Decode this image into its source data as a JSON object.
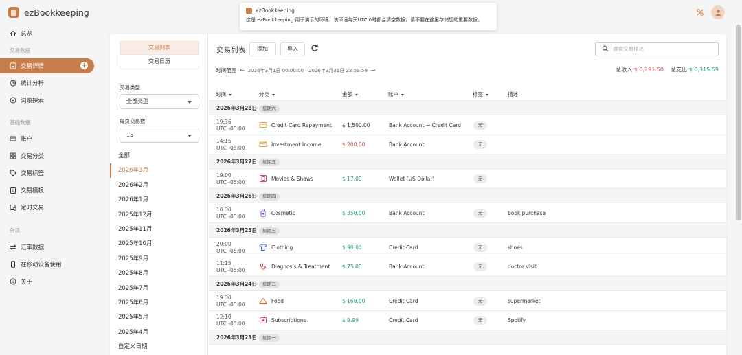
{
  "app": {
    "name": "ezBookkeeping"
  },
  "notice": {
    "title": "ezBookkeeping",
    "text": "这是 ezBookkeeping 用于演示的环境，该环境每天UTC 0时都会清空数据，请不要在这里存储您的重要数据。"
  },
  "sidebar": {
    "overview": "总览",
    "section_tx": "交易数据",
    "tx_detail": "交易详情",
    "stats": "统计分析",
    "explore": "洞察探索",
    "section_base": "基础数据",
    "accounts": "账户",
    "categories": "交易分类",
    "tags": "交易标签",
    "templates": "交易模板",
    "scheduled": "定时交易",
    "section_misc": "杂项",
    "exchange": "汇率数据",
    "mobile": "在移动设备使用",
    "about": "关于"
  },
  "filter": {
    "tab_list": "交易列表",
    "tab_calendar": "交易日历",
    "type_label": "交易类型",
    "type_value": "全部类型",
    "perpage_label": "每页交易数",
    "perpage_value": "15",
    "dates": [
      "全部",
      "2026年3月",
      "2026年2月",
      "2026年1月",
      "2025年12月",
      "2025年11月",
      "2025年10月",
      "2025年9月",
      "2025年8月",
      "2025年7月",
      "2025年6月",
      "2025年5月",
      "2025年4月",
      "自定义日期"
    ],
    "active_date": "2026年3月"
  },
  "toolbar": {
    "title": "交易列表",
    "add": "添加",
    "import": "导入",
    "search_placeholder": "搜索交易描述"
  },
  "range": {
    "label": "时间范围",
    "value": "2026年3月1日 00:00:00 - 2026年3月31日 23:59:59"
  },
  "totals": {
    "income_label": "总收入",
    "income": "$ 6,291.50",
    "expense_label": "总支出",
    "expense": "$ 6,315.59"
  },
  "table": {
    "headers": {
      "time": "时间",
      "category": "分类",
      "amount": "金额",
      "account": "账户",
      "tag": "标签",
      "desc": "描述"
    },
    "groups": [
      {
        "date": "2026年3月28日",
        "weekday": "星期六",
        "rows": [
          {
            "time": "19:36",
            "tz": "UTC -05:00",
            "category": "Credit Card Repayment",
            "icon": "credit-card-icon",
            "icon_color": "#e8a33a",
            "amount": "$ 1,500.00",
            "amount_type": "transfer",
            "account": "Bank Account → Credit Card",
            "tag": "无",
            "desc": ""
          },
          {
            "time": "14:15",
            "tz": "UTC -05:00",
            "category": "Investment Income",
            "icon": "money-icon",
            "icon_color": "#e8a33a",
            "amount": "$ 200.00",
            "amount_type": "income",
            "account": "Bank Account",
            "tag": "无",
            "desc": ""
          }
        ]
      },
      {
        "date": "2026年3月27日",
        "weekday": "星期五",
        "rows": [
          {
            "time": "19:00",
            "tz": "UTC -05:00",
            "category": "Movies & Shows",
            "icon": "film-icon",
            "icon_color": "#d0457a",
            "amount": "$ 17.00",
            "amount_type": "expense",
            "account": "Wallet (US Dollar)",
            "tag": "无",
            "desc": ""
          }
        ]
      },
      {
        "date": "2026年3月26日",
        "weekday": "星期四",
        "rows": [
          {
            "time": "10:30",
            "tz": "UTC -05:00",
            "category": "Cosmetic",
            "icon": "bottle-icon",
            "icon_color": "#7b55c7",
            "amount": "$ 350.00",
            "amount_type": "expense",
            "account": "Bank Account",
            "tag": "无",
            "desc": "book purchase"
          }
        ]
      },
      {
        "date": "2026年3月25日",
        "weekday": "星期三",
        "rows": [
          {
            "time": "20:00",
            "tz": "UTC -05:00",
            "category": "Clothing",
            "icon": "shirt-icon",
            "icon_color": "#4a5fd0",
            "amount": "$ 90.00",
            "amount_type": "expense",
            "account": "Credit Card",
            "tag": "无",
            "desc": "shoes"
          },
          {
            "time": "11:15",
            "tz": "UTC -05:00",
            "category": "Diagnosis & Treatment",
            "icon": "stethoscope-icon",
            "icon_color": "#d2504f",
            "amount": "$ 75.00",
            "amount_type": "expense",
            "account": "Bank Account",
            "tag": "无",
            "desc": "doctor visit"
          }
        ]
      },
      {
        "date": "2026年3月24日",
        "weekday": "星期二",
        "rows": [
          {
            "time": "19:30",
            "tz": "UTC -05:00",
            "category": "Food",
            "icon": "food-icon",
            "icon_color": "#e46a3e",
            "amount": "$ 160.00",
            "amount_type": "expense",
            "account": "Credit Card",
            "tag": "无",
            "desc": "supermarket"
          },
          {
            "time": "12:10",
            "tz": "UTC -05:00",
            "category": "Subscriptions",
            "icon": "subscription-icon",
            "icon_color": "#d0457a",
            "amount": "$ 9.99",
            "amount_type": "expense",
            "account": "Credit Card",
            "tag": "无",
            "desc": "Spotify"
          }
        ]
      },
      {
        "date": "2026年3月23日",
        "weekday": "星期一",
        "rows": []
      }
    ]
  },
  "colors": {
    "accent": "#c67f4b",
    "income": "#d2504f",
    "expense": "#1f9f84"
  }
}
